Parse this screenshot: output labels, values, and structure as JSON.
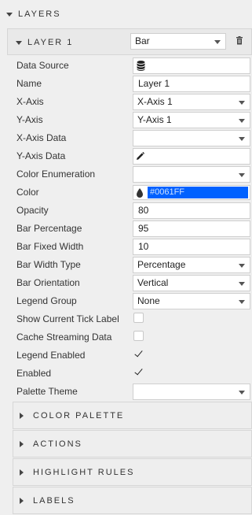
{
  "layers_header": "LAYERS",
  "layer": {
    "title": "LAYER 1",
    "type_value": "Bar"
  },
  "rows": {
    "data_source": "Data Source",
    "name": "Name",
    "name_value": "Layer 1",
    "x_axis": "X-Axis",
    "x_axis_value": "X-Axis 1",
    "y_axis": "Y-Axis",
    "y_axis_value": "Y-Axis 1",
    "x_axis_data": "X-Axis Data",
    "y_axis_data": "Y-Axis Data",
    "color_enum": "Color Enumeration",
    "color": "Color",
    "color_value": "#0061FF",
    "opacity": "Opacity",
    "opacity_value": "80",
    "bar_percentage": "Bar Percentage",
    "bar_percentage_value": "95",
    "bar_fixed_width": "Bar Fixed Width",
    "bar_fixed_width_value": "10",
    "bar_width_type": "Bar Width Type",
    "bar_width_type_value": "Percentage",
    "bar_orientation": "Bar Orientation",
    "bar_orientation_value": "Vertical",
    "legend_group": "Legend Group",
    "legend_group_value": "None",
    "show_tick": "Show Current Tick Label",
    "cache_streaming": "Cache Streaming Data",
    "legend_enabled": "Legend Enabled",
    "enabled": "Enabled",
    "palette_theme": "Palette Theme"
  },
  "checkboxes": {
    "show_tick": false,
    "cache_streaming": false,
    "legend_enabled": true,
    "enabled": true
  },
  "sections": {
    "color_palette": "COLOR PALETTE",
    "actions": "ACTIONS",
    "highlight_rules": "HIGHLIGHT RULES",
    "labels": "LABELS"
  },
  "colors": {
    "accent": "#0061FF",
    "background": "#efefef"
  },
  "icons": {
    "database": "database-icon",
    "pencil": "pencil-icon",
    "trash": "trash-icon",
    "droplet": "droplet-icon"
  }
}
